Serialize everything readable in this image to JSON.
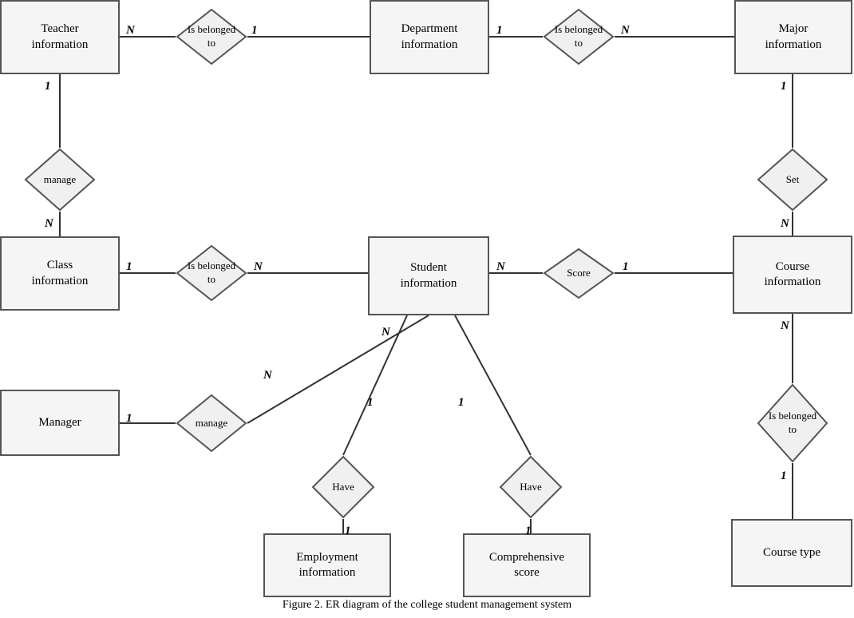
{
  "title": "ER diagram of the college student management system",
  "caption": "Figure 2.    ER diagram of the college student management system",
  "entities": {
    "teacher": {
      "label": "Teacher\ninformation"
    },
    "department": {
      "label": "Department\ninformation"
    },
    "major": {
      "label": "Major\ninformation"
    },
    "class": {
      "label": "Class\ninformation"
    },
    "student": {
      "label": "Student\ninformation"
    },
    "course": {
      "label": "Course\ninformation"
    },
    "manager": {
      "label": "Manager"
    },
    "employment": {
      "label": "Employment\ninformation"
    },
    "comprehensive": {
      "label": "Comprehensive\nscore"
    },
    "course_type": {
      "label": "Course type"
    }
  },
  "relationships": {
    "belonged1": {
      "label": "Is belonged\nto"
    },
    "belonged2": {
      "label": "Is belonged\nto"
    },
    "manage_teacher": {
      "label": "manage"
    },
    "set": {
      "label": "Set"
    },
    "belonged_class": {
      "label": "Is belonged\nto"
    },
    "score": {
      "label": "Score"
    },
    "manage_manager": {
      "label": "manage"
    },
    "have_employment": {
      "label": "Have"
    },
    "have_comprehensive": {
      "label": "Have"
    },
    "belonged_course": {
      "label": "Is belonged\nto"
    }
  },
  "multiplicity": {
    "n": "N",
    "one": "1"
  }
}
